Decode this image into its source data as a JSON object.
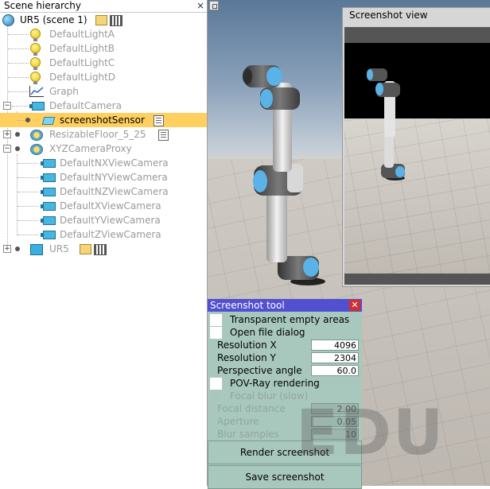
{
  "hierarchy": {
    "title": "Scene hierarchy",
    "close_glyph": "×",
    "root": {
      "label": "UR5 (scene 1)",
      "icon": "globe-icon"
    },
    "items": [
      {
        "label": "DefaultLightA",
        "icon": "light-icon"
      },
      {
        "label": "DefaultLightB",
        "icon": "light-icon"
      },
      {
        "label": "DefaultLightC",
        "icon": "light-icon"
      },
      {
        "label": "DefaultLightD",
        "icon": "light-icon"
      },
      {
        "label": "Graph",
        "icon": "graph-icon"
      },
      {
        "label": "DefaultCamera",
        "icon": "camera-icon"
      },
      {
        "label": "screenshotSensor",
        "icon": "vision-sensor-icon",
        "selected": true
      },
      {
        "label": "ResizableFloor_5_25",
        "icon": "floor-icon"
      },
      {
        "label": "XYZCameraProxy",
        "icon": "floor-icon"
      },
      {
        "label": "DefaultNXViewCamera",
        "icon": "camera-icon"
      },
      {
        "label": "DefaultNYViewCamera",
        "icon": "camera-icon"
      },
      {
        "label": "DefaultNZViewCamera",
        "icon": "camera-icon"
      },
      {
        "label": "DefaultXViewCamera",
        "icon": "camera-icon"
      },
      {
        "label": "DefaultYViewCamera",
        "icon": "camera-icon"
      },
      {
        "label": "DefaultZViewCamera",
        "icon": "camera-icon"
      },
      {
        "label": "UR5",
        "icon": "robot-icon"
      }
    ]
  },
  "screenshot_view": {
    "title": "Screenshot view"
  },
  "tool": {
    "title": "Screenshot tool",
    "close_glyph": "✕",
    "transparent_label": "Transparent empty areas",
    "open_dialog_label": "Open file dialog",
    "res_x_label": "Resolution X",
    "res_x_value": "4096",
    "res_y_label": "Resolution Y",
    "res_y_value": "2304",
    "persp_label": "Perspective angle",
    "persp_value": "60.0",
    "povray_label": "POV-Ray rendering",
    "focal_blur_label": "Focal blur (slow)",
    "focal_dist_label": "Focal distance",
    "focal_dist_value": "2.00",
    "aperture_label": "Aperture",
    "aperture_value": "0.05",
    "blur_samples_label": "Blur samples",
    "blur_samples_value": "10",
    "render_label": "Render screenshot",
    "save_label": "Save screenshot"
  },
  "watermark": "EDU",
  "colors": {
    "selection": "#ffd060",
    "tool_bg": "#a9c8bd",
    "tool_title": "#5050d0",
    "close_red": "#d03030"
  }
}
